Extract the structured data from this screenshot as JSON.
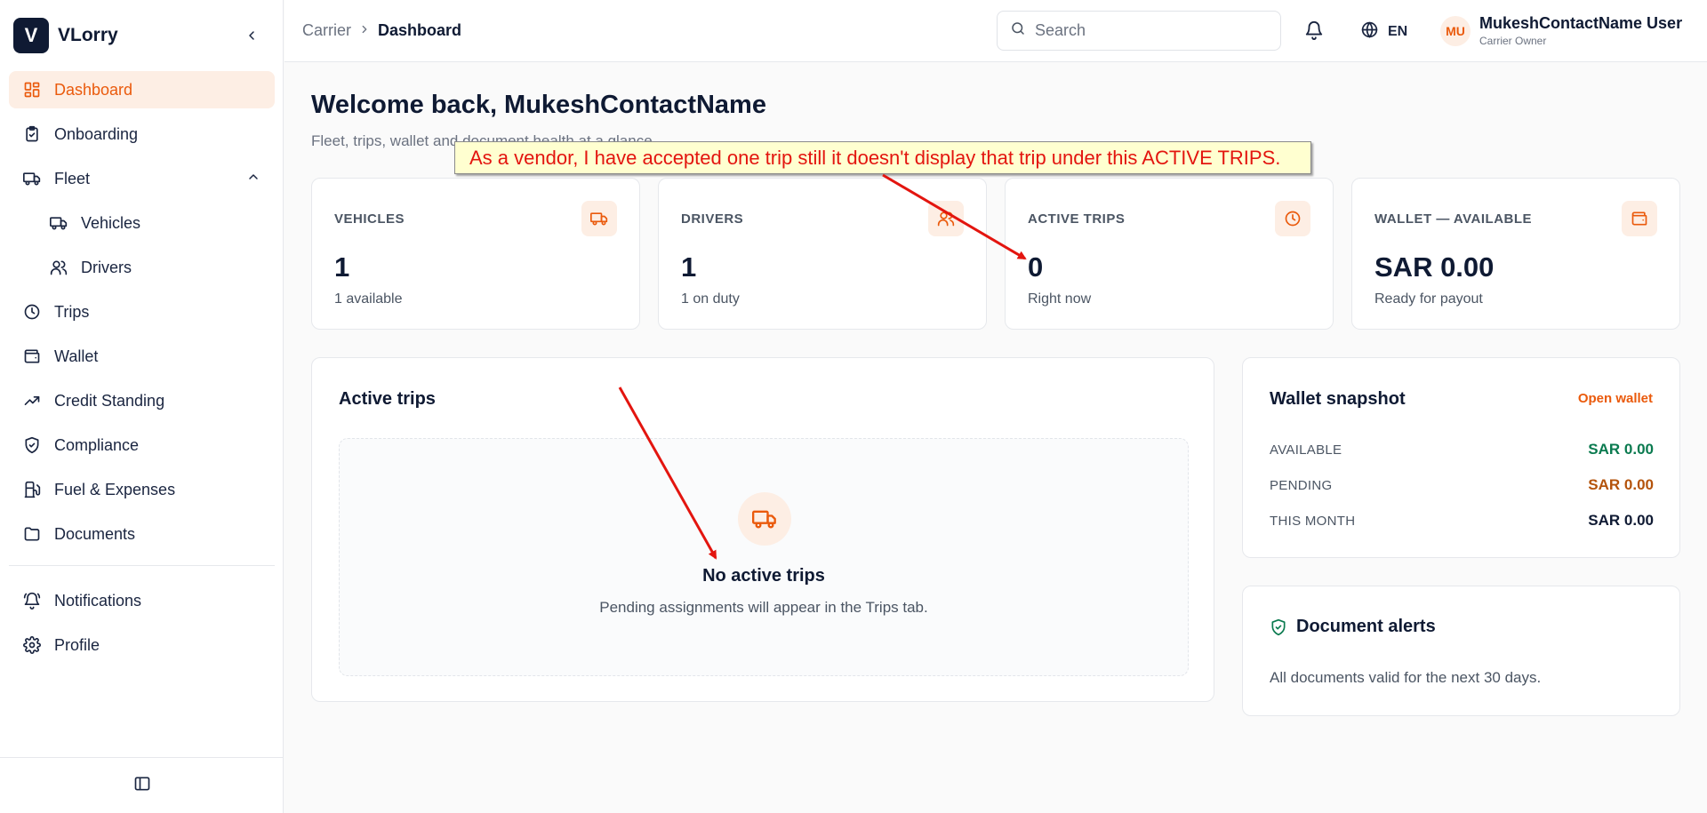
{
  "brand": {
    "logo_letter": "V",
    "name": "VLorry"
  },
  "sidebar": {
    "items": [
      {
        "key": "dashboard",
        "label": "Dashboard",
        "icon": "dashboard-icon",
        "active": true
      },
      {
        "key": "onboarding",
        "label": "Onboarding",
        "icon": "clipboard-icon"
      },
      {
        "key": "fleet",
        "label": "Fleet",
        "icon": "truck-icon",
        "expanded": true
      },
      {
        "key": "vehicles",
        "label": "Vehicles",
        "icon": "truck-icon",
        "sub": true
      },
      {
        "key": "drivers",
        "label": "Drivers",
        "icon": "users-icon",
        "sub": true
      },
      {
        "key": "trips",
        "label": "Trips",
        "icon": "clock-icon"
      },
      {
        "key": "wallet",
        "label": "Wallet",
        "icon": "wallet-icon"
      },
      {
        "key": "credit",
        "label": "Credit Standing",
        "icon": "trending-up-icon"
      },
      {
        "key": "compliance",
        "label": "Compliance",
        "icon": "shield-check-icon"
      },
      {
        "key": "fuel",
        "label": "Fuel & Expenses",
        "icon": "fuel-icon"
      },
      {
        "key": "documents",
        "label": "Documents",
        "icon": "folder-icon"
      },
      {
        "key": "notifications",
        "label": "Notifications",
        "icon": "bell-icon"
      },
      {
        "key": "profile",
        "label": "Profile",
        "icon": "gear-icon"
      }
    ]
  },
  "header": {
    "breadcrumb": {
      "parent": "Carrier",
      "current": "Dashboard"
    },
    "search_placeholder": "Search",
    "language": "EN",
    "user": {
      "initials": "MU",
      "name": "MukeshContactName User",
      "role": "Carrier Owner"
    }
  },
  "main": {
    "welcome": "Welcome back, MukeshContactName",
    "subtitle": "Fleet, trips, wallet and document health at a glance.",
    "stats": [
      {
        "label": "VEHICLES",
        "value": "1",
        "note": "1 available",
        "icon": "truck-icon"
      },
      {
        "label": "DRIVERS",
        "value": "1",
        "note": "1 on duty",
        "icon": "users-icon"
      },
      {
        "label": "ACTIVE TRIPS",
        "value": "0",
        "note": "Right now",
        "icon": "clock-icon"
      },
      {
        "label": "WALLET — AVAILABLE",
        "value": "SAR 0.00",
        "note": "Ready for payout",
        "icon": "wallet-icon"
      }
    ],
    "active_trips": {
      "title": "Active trips",
      "empty_title": "No active trips",
      "empty_desc": "Pending assignments will appear in the Trips tab."
    },
    "wallet_snapshot": {
      "title": "Wallet snapshot",
      "link": "Open wallet",
      "rows": [
        {
          "label": "AVAILABLE",
          "value": "SAR 0.00",
          "color": "#0a7a4f"
        },
        {
          "label": "PENDING",
          "value": "SAR 0.00",
          "color": "#b4530b"
        },
        {
          "label": "THIS MONTH",
          "value": "SAR 0.00",
          "color": "#0f1a33"
        }
      ]
    },
    "document_alerts": {
      "title": "Document alerts",
      "desc": "All documents valid for the next 30 days."
    }
  },
  "annotation": {
    "text": "As a vendor, I have accepted one trip still it doesn't display that trip under this ACTIVE TRIPS."
  },
  "colors": {
    "accent": "#ea5a0c",
    "accent_bg": "#fdeee4",
    "navy": "#0f1a33",
    "annotation_red": "#e3150f"
  }
}
